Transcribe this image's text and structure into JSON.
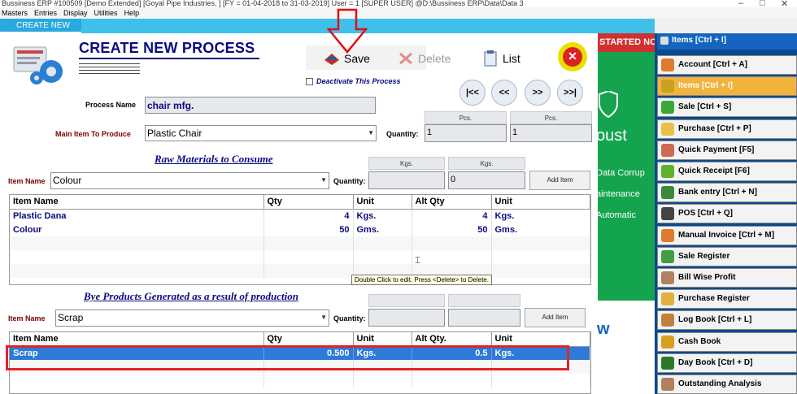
{
  "window": {
    "title": "Bussiness ERP #100509 [Demo Extended] [Goyal Pipe Industries, ] [FY = 01-04-2018 to 31-03-2019] User = 1 [SUPER USER] @D:\\Bussiness ERP\\Data\\Data 3"
  },
  "menu": [
    "Masters",
    "Entries",
    "Display",
    "Utilities",
    "Help"
  ],
  "tabs": {
    "active": "CREATE NEW"
  },
  "form": {
    "title": "CREATE NEW PROCESS",
    "toolbar": {
      "save": "Save",
      "delete": "Delete",
      "list": "List"
    },
    "deactivate_label": "Deactivate This Process",
    "nav": {
      "first": "|<<",
      "prev": "<<",
      "next": ">>",
      "last": ">>|"
    },
    "process_name_label": "Process Name",
    "process_name_value": "chair mfg.",
    "main_item_label": "Main Item To Produce",
    "main_item_value": "Plastic Chair",
    "quantity_label": "Quantity:",
    "main_units": [
      "Pcs.",
      "Pcs."
    ],
    "main_qty": [
      "1",
      "1"
    ],
    "raw": {
      "title": "Raw Materials to Consume",
      "item_name_label": "Item Name",
      "item_value": "Colour",
      "quantity_label": "Quantity:",
      "units": [
        "Kgs.",
        "Kgs."
      ],
      "qty": [
        "",
        "0"
      ],
      "add_button": "Add Item",
      "headers": [
        "Item Name",
        "Qty",
        "Unit",
        "Alt Qty",
        "Unit"
      ],
      "rows": [
        [
          "Plastic Dana",
          "4",
          "Kgs.",
          "4",
          "Kgs."
        ],
        [
          "Colour",
          "50",
          "Gms.",
          "50",
          "Gms."
        ]
      ]
    },
    "tooltip": "Double Click to edit.  Press <Delete> to Delete.",
    "bye": {
      "title": "Bye Products Generated as a result of production",
      "item_name_label": "Item Name",
      "item_value": "Scrap",
      "quantity_label": "Quantity:",
      "qty": [
        "",
        ""
      ],
      "add_button": "Add Item",
      "headers": [
        "Item Name",
        "Qty",
        "Unit",
        "Alt Qty.",
        "Unit"
      ],
      "rows": [
        [
          "Scrap",
          "0.500",
          "Kgs.",
          "0.5",
          "Kgs."
        ]
      ]
    }
  },
  "banner": "STARTED NO",
  "green_panel": [
    "oust",
    "Data Corrup",
    "aintenance",
    "Automatic",
    "w"
  ],
  "sidebar": {
    "header": "Items [Ctrl + I]",
    "items": [
      {
        "label": "Account [Ctrl + A]",
        "icon": "account-icon",
        "color": "#e07a2e"
      },
      {
        "label": "Items [Ctrl + I]",
        "icon": "items-icon",
        "color": "#caa020"
      },
      {
        "label": "Sale [Ctrl + S]",
        "icon": "sale-icon",
        "color": "#38a838"
      },
      {
        "label": "Purchase [Ctrl + P]",
        "icon": "purchase-icon",
        "color": "#e8c04a"
      },
      {
        "label": "Quick Payment [F5]",
        "icon": "payment-icon",
        "color": "#d06a50"
      },
      {
        "label": "Quick Receipt [F6]",
        "icon": "receipt-icon",
        "color": "#60b030"
      },
      {
        "label": "Bank entry [Ctrl + N]",
        "icon": "bank-icon",
        "color": "#3a8a3a"
      },
      {
        "label": "POS [Ctrl + Q]",
        "icon": "pos-icon",
        "color": "#444"
      },
      {
        "label": "Manual Invoice [Ctrl + M]",
        "icon": "invoice-icon",
        "color": "#e07a2e"
      },
      {
        "label": "Sale Register",
        "icon": "sale-register-icon",
        "color": "#40a040"
      },
      {
        "label": "Bill Wise Profit",
        "icon": "profit-icon",
        "color": "#b08060"
      },
      {
        "label": "Purchase Register",
        "icon": "purchase-register-icon",
        "color": "#e0b040"
      },
      {
        "label": "Log Book [Ctrl + L]",
        "icon": "log-book-icon",
        "color": "#c08040"
      },
      {
        "label": "Cash Book",
        "icon": "cash-book-icon",
        "color": "#d8a020"
      },
      {
        "label": "Day Book [Ctrl + D]",
        "icon": "day-book-icon",
        "color": "#2a7a2a"
      },
      {
        "label": "Outstanding Analysis",
        "icon": "outstanding-icon",
        "color": "#b08060"
      }
    ]
  }
}
